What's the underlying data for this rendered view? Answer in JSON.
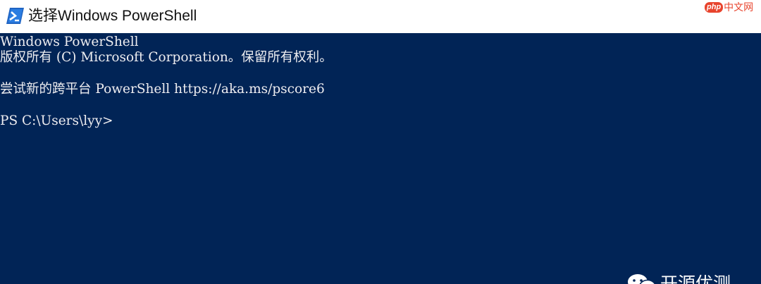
{
  "window": {
    "title": "选择Windows PowerShell",
    "icon": "powershell-icon"
  },
  "console": {
    "lines": [
      "Windows PowerShell",
      "版权所有 (C) Microsoft Corporation。保留所有权利。",
      "尝试新的跨平台 PowerShell https://aka.ms/pscore6",
      "PS C:\\Users\\lyy>"
    ],
    "background": "#012456",
    "foreground": "#eeedf0"
  },
  "overlay": {
    "php_logo": {
      "mark": "php",
      "text": "中文网",
      "color": "#e8442d"
    },
    "watermark": {
      "icon": "wechat-icon",
      "text": "开源优测"
    }
  }
}
